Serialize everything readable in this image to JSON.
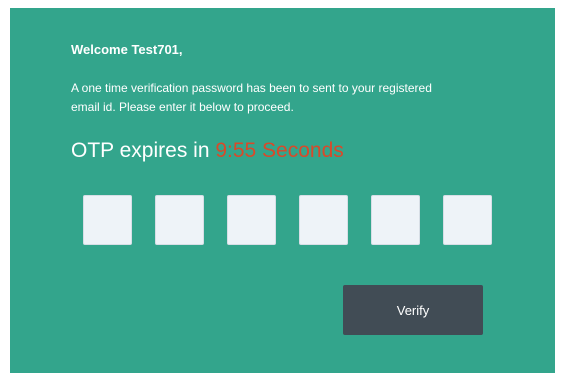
{
  "greeting": "Welcome Test701,",
  "message_line1": "A one time verification password has been to sent to your registered",
  "message_line2": "email id. Please enter it below to proceed.",
  "expiry": {
    "prefix": "OTP expires in ",
    "timer": "9:55 Seconds"
  },
  "otp_inputs": [
    "",
    "",
    "",
    "",
    "",
    ""
  ],
  "verify_label": "Verify",
  "colors": {
    "card_background": "#33a58c",
    "timer_text": "#d84a2a",
    "button_background": "#414c55",
    "input_background": "#eef3f8"
  }
}
